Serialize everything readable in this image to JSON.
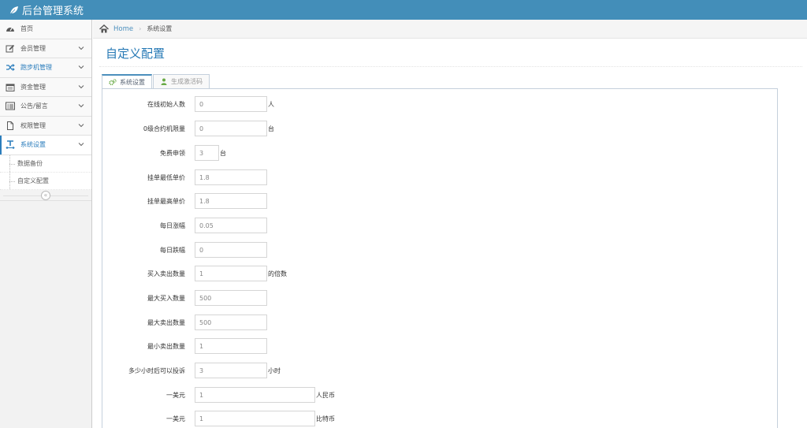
{
  "app": {
    "title": "后台管理系统"
  },
  "sidebar": {
    "items": [
      {
        "label": "首页",
        "icon": "dashboard-icon"
      },
      {
        "label": "会员管理",
        "icon": "edit-icon"
      },
      {
        "label": "跑步机管理",
        "icon": "shuffle-icon"
      },
      {
        "label": "资金管理",
        "icon": "calendar-icon"
      },
      {
        "label": "公告/留言",
        "icon": "list-alt-icon"
      },
      {
        "label": "权限管理",
        "icon": "file-icon"
      },
      {
        "label": "系统设置",
        "icon": "text-width-icon"
      }
    ],
    "sub_items": [
      {
        "label": "数据备份"
      },
      {
        "label": "自定义配置"
      }
    ],
    "collapse_glyph": "«"
  },
  "breadcrumb": {
    "home": "Home",
    "current": "系统设置"
  },
  "page": {
    "title": "自定义配置"
  },
  "tabs": [
    {
      "label": "系统设置",
      "icon": "cogs-icon"
    },
    {
      "label": "生成激活码",
      "icon": "user-icon"
    }
  ],
  "form": {
    "fields": [
      {
        "label": "在线初始人数",
        "value": "0",
        "suffix": "人"
      },
      {
        "label": "0级合约机限量",
        "value": "0",
        "suffix": "台"
      },
      {
        "label": "免费申领",
        "value": "3",
        "suffix": "台"
      },
      {
        "label": "挂单最低单价",
        "value": "1.8",
        "suffix": ""
      },
      {
        "label": "挂单最高单价",
        "value": "1.8",
        "suffix": ""
      },
      {
        "label": "每日涨幅",
        "value": "0.05",
        "suffix": ""
      },
      {
        "label": "每日跌幅",
        "value": "0",
        "suffix": ""
      },
      {
        "label": "买入卖出数量",
        "value": "1",
        "suffix": "的倍数"
      },
      {
        "label": "最大买入数量",
        "value": "500",
        "suffix": ""
      },
      {
        "label": "最大卖出数量",
        "value": "500",
        "suffix": ""
      },
      {
        "label": "最小卖出数量",
        "value": "1",
        "suffix": ""
      },
      {
        "label": "多少小时后可以投诉",
        "value": "3",
        "suffix": "小时"
      },
      {
        "label": "一美元",
        "value": "1",
        "suffix": "人民币"
      },
      {
        "label": "一美元",
        "value": "1",
        "suffix": "比特币"
      }
    ]
  },
  "colors": {
    "topbar": "#438eb9",
    "accent": "#2679b5",
    "link": "#4c8fbd"
  }
}
